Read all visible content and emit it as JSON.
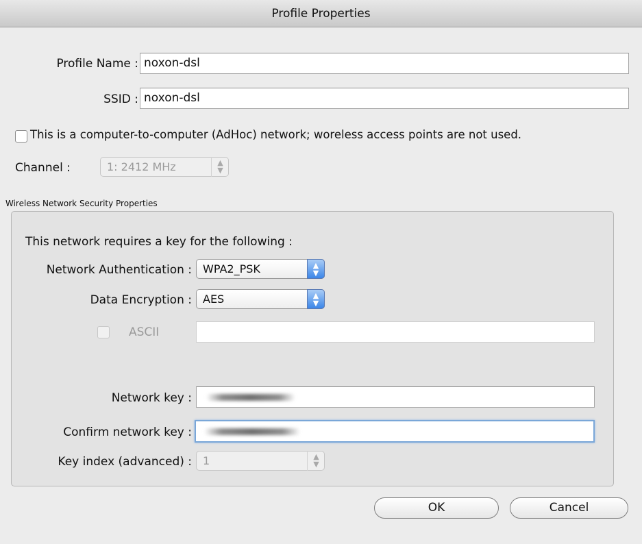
{
  "window": {
    "title": "Profile Properties"
  },
  "profile": {
    "name_label": "Profile Name :",
    "name_value": "noxon-dsl",
    "ssid_label": "SSID :",
    "ssid_value": "noxon-dsl"
  },
  "adhoc": {
    "label": "This is a computer-to-computer (AdHoc) network; woreless access points are not used.",
    "checked": false
  },
  "channel": {
    "label": "Channel :",
    "value": "1: 2412 MHz"
  },
  "security": {
    "group_title": "Wireless Network Security Properties",
    "requires_key": "This network requires a key for the following :",
    "auth_label": "Network Authentication :",
    "auth_value": "WPA2_PSK",
    "enc_label": "Data Encryption :",
    "enc_value": "AES",
    "ascii_label": "ASCII",
    "ascii_value": "",
    "key_label": "Network key :",
    "confirm_label": "Confirm network key :",
    "index_label": "Key index (advanced) :",
    "index_value": "1"
  },
  "buttons": {
    "ok": "OK",
    "cancel": "Cancel"
  }
}
